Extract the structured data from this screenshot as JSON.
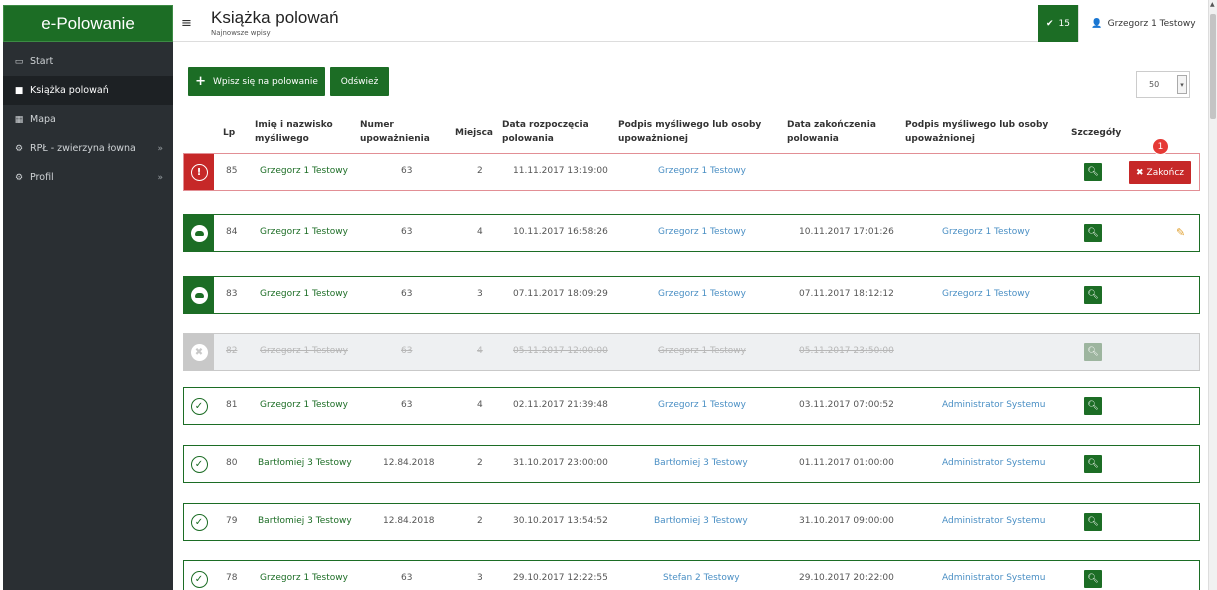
{
  "app": {
    "brand": "e-Polowanie"
  },
  "sidebar": {
    "items": [
      {
        "label": "Start",
        "icon": "monitor-icon"
      },
      {
        "label": "Książka polowań",
        "icon": "book-icon",
        "active": true
      },
      {
        "label": "Mapa",
        "icon": "map-icon"
      },
      {
        "label": "RPŁ - zwierzyna łowna",
        "icon": "cogs-icon",
        "expandable": true
      },
      {
        "label": "Profil",
        "icon": "cogs-icon",
        "expandable": true
      }
    ]
  },
  "header": {
    "title": "Książka polowań",
    "subtitle": "Najnowsze wpisy",
    "notification_count": "15",
    "user_name": "Grzegorz 1 Testowy"
  },
  "toolbar": {
    "add_label": "Wpisz się na polowanie",
    "refresh_label": "Odśwież",
    "page_size": "50"
  },
  "table": {
    "headers": {
      "lp": "Lp",
      "name_1": "Imię i nazwisko",
      "name_2": "myśliwego",
      "auth_1": "Numer",
      "auth_2": "upoważnienia",
      "place": "Miejsca",
      "start_1": "Data rozpoczęcia",
      "start_2": "polowania",
      "sig1_1": "Podpis myśliwego lub osoby",
      "sig1_2": "upoważnionej",
      "end_1": "Data zakończenia",
      "end_2": "polowania",
      "sig2_1": "Podpis myśliwego lub osoby",
      "sig2_2": "upoważnionej",
      "details": "Szczegóły"
    },
    "finish_label": "Zakończ",
    "finish_badge": "1",
    "rows": [
      {
        "lp": "85",
        "name": "Grzegorz 1 Testowy",
        "auth": "63",
        "place": "2",
        "start": "11.11.2017 13:19:00",
        "sig1": "Grzegorz 1 Testowy",
        "end": "",
        "sig2": "",
        "status": "alert"
      },
      {
        "lp": "84",
        "name": "Grzegorz 1 Testowy",
        "auth": "63",
        "place": "4",
        "start": "10.11.2017 16:58:26",
        "sig1": "Grzegorz 1 Testowy",
        "end": "10.11.2017 17:01:26",
        "sig2": "Grzegorz 1 Testowy",
        "status": "boar"
      },
      {
        "lp": "83",
        "name": "Grzegorz 1 Testowy",
        "auth": "63",
        "place": "3",
        "start": "07.11.2017 18:09:29",
        "sig1": "Grzegorz 1 Testowy",
        "end": "07.11.2017 18:12:12",
        "sig2": "Grzegorz 1 Testowy",
        "status": "boar"
      },
      {
        "lp": "82",
        "name": "Grzegorz 1 Testowy",
        "auth": "63",
        "place": "4",
        "start": "05.11.2017 12:00:00",
        "sig1": "Grzegorz 1 Testowy",
        "end": "05.11.2017 23:50:00",
        "sig2": "",
        "status": "cancelled"
      },
      {
        "lp": "81",
        "name": "Grzegorz 1 Testowy",
        "auth": "63",
        "place": "4",
        "start": "02.11.2017 21:39:48",
        "sig1": "Grzegorz 1 Testowy",
        "end": "03.11.2017 07:00:52",
        "sig2": "Administrator Systemu",
        "status": "ok"
      },
      {
        "lp": "80",
        "name": "Bartłomiej 3 Testowy",
        "auth": "12.84.2018",
        "place": "2",
        "start": "31.10.2017 23:00:00",
        "sig1": "Bartłomiej 3 Testowy",
        "end": "01.11.2017 01:00:00",
        "sig2": "Administrator Systemu",
        "status": "ok"
      },
      {
        "lp": "79",
        "name": "Bartłomiej 3 Testowy",
        "auth": "12.84.2018",
        "place": "2",
        "start": "30.10.2017 13:54:52",
        "sig1": "Bartłomiej 3 Testowy",
        "end": "31.10.2017 09:00:00",
        "sig2": "Administrator Systemu",
        "status": "ok"
      },
      {
        "lp": "78",
        "name": "Grzegorz 1 Testowy",
        "auth": "63",
        "place": "3",
        "start": "29.10.2017 12:22:55",
        "sig1": "Stefan 2 Testowy",
        "end": "29.10.2017 20:22:00",
        "sig2": "Administrator Systemu",
        "status": "ok"
      }
    ]
  }
}
